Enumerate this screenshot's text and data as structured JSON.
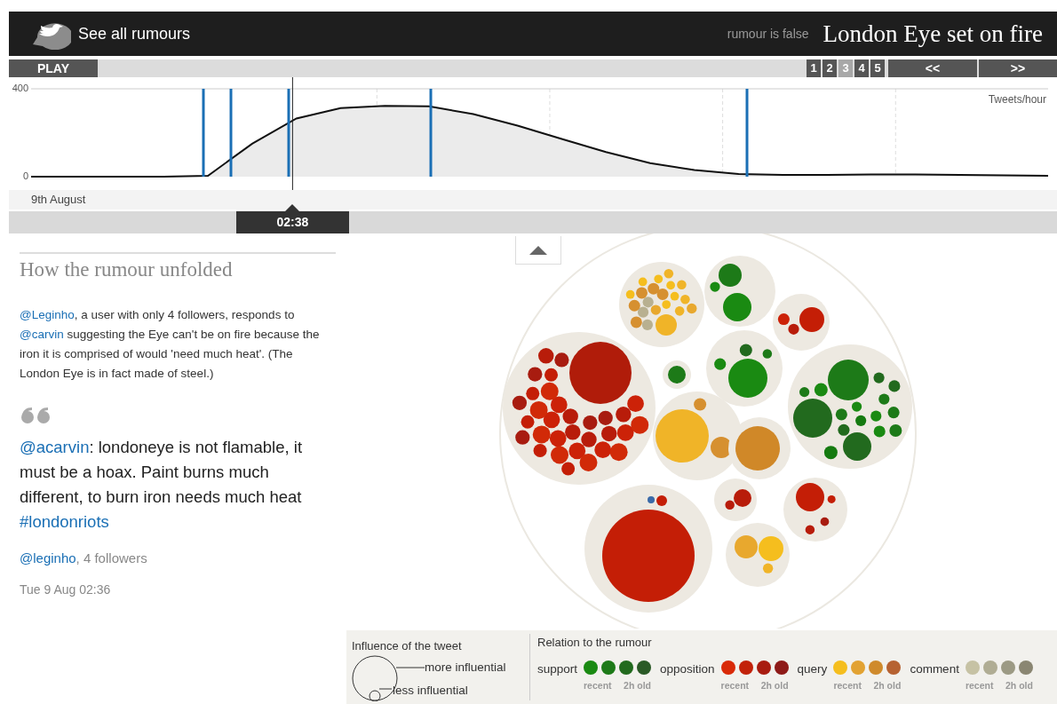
{
  "header": {
    "back_link": "See all rumours",
    "verdict": "rumour is false",
    "title": "London Eye set on fire"
  },
  "controls": {
    "play": "PLAY",
    "pages": [
      {
        "label": "1",
        "selected": false
      },
      {
        "label": "2",
        "selected": false
      },
      {
        "label": "3",
        "selected": true
      },
      {
        "label": "4",
        "selected": false
      },
      {
        "label": "5",
        "selected": false
      }
    ],
    "prev": "<<",
    "next": ">>"
  },
  "timeline": {
    "chart_data": {
      "type": "area",
      "ylabel": "Tweets/hour",
      "categories": [
        null,
        null,
        null,
        null,
        null,
        null,
        null,
        null,
        null,
        null,
        null,
        null,
        null,
        null,
        null,
        null,
        null,
        null,
        null,
        null,
        null,
        null,
        null,
        null
      ],
      "ylim": [
        0,
        400
      ],
      "yticks": [
        0,
        400
      ],
      "values": [
        0,
        0,
        0,
        0,
        4,
        150,
        265,
        312,
        322,
        320,
        285,
        232,
        172,
        112,
        62,
        30,
        12,
        8,
        8,
        10,
        10,
        8,
        6,
        4
      ]
    },
    "date": "9th August",
    "playhead": {
      "label": "02:38",
      "level": 0.243
    }
  },
  "story": {
    "heading": "How the rumour unfolded",
    "summary": [
      {
        "text": "@Leginho",
        "kind": "link"
      },
      {
        "text": ", a user with only 4 followers, responds to ",
        "kind": "text"
      },
      {
        "text": "@carvin",
        "kind": "link"
      },
      {
        "text": " suggesting the Eye can't be on fire because the iron it is comprised of would 'need much heat'. (The London Eye is in fact made of steel.)",
        "kind": "text"
      }
    ],
    "tweet": [
      {
        "text": "@acarvin",
        "kind": "link"
      },
      {
        "text": ": londoneye is not flamable, it must be a hoax. Paint burns much different, to burn iron needs much heat ",
        "kind": "text"
      },
      {
        "text": "#londonriots",
        "kind": "link"
      }
    ],
    "author": [
      {
        "text": "@leginho",
        "kind": "link"
      },
      {
        "text": ", 4 followers",
        "kind": "text"
      }
    ],
    "date": "Tue 9 Aug 02:36"
  },
  "legend": {
    "influence": {
      "title": "Influence of the tweet",
      "more": "more influential",
      "less": "less influential"
    },
    "relation": {
      "title": "Relation to the rumour",
      "categories": [
        {
          "name": "support",
          "dots": [
            {
              "color": "#1a8a12"
            },
            {
              "color": "#1d7a18"
            },
            {
              "color": "#226a1e"
            },
            {
              "color": "#2a5a26"
            }
          ],
          "labels": [
            "recent",
            "2h old"
          ]
        },
        {
          "name": "opposition",
          "dots": [
            {
              "color": "#d92a08"
            },
            {
              "color": "#c2220a"
            },
            {
              "color": "#a81c10"
            },
            {
              "color": "#8e1a18"
            }
          ],
          "labels": [
            "recent",
            "2h old"
          ]
        },
        {
          "name": "query",
          "dots": [
            {
              "color": "#f5be1e"
            },
            {
              "color": "#e2a232"
            },
            {
              "color": "#cf8a2c"
            },
            {
              "color": "#b66232"
            }
          ],
          "labels": [
            "recent",
            "2h old"
          ]
        },
        {
          "name": "comment",
          "dots": [
            {
              "color": "#c6c2a4"
            },
            {
              "color": "#b0ad94"
            },
            {
              "color": "#9c9a84"
            },
            {
              "color": "#8a8672"
            }
          ],
          "labels": [
            "recent",
            "2h old"
          ]
        }
      ]
    }
  }
}
